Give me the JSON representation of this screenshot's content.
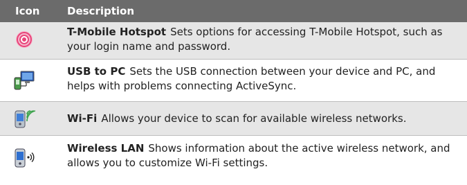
{
  "header": {
    "icon_label": "Icon",
    "description_label": "Description"
  },
  "rows": [
    {
      "icon": "hotspot-icon",
      "title": "T-Mobile Hotspot",
      "text": "Sets options for accessing T-Mobile Hotspot, such as your login name and password."
    },
    {
      "icon": "usb-to-pc-icon",
      "title": "USB to PC",
      "text": "Sets the USB connection between your device and PC, and helps with problems connecting ActiveSync."
    },
    {
      "icon": "wifi-icon",
      "title": "Wi-Fi",
      "text": "Allows your device to scan for available wireless networks."
    },
    {
      "icon": "wireless-lan-icon",
      "title": "Wireless LAN",
      "text": "Shows information about the active wireless network, and allows you to customize Wi-Fi settings."
    }
  ],
  "colors": {
    "header_bg": "#6b6b6b",
    "shaded_row": "#e6e6e6",
    "hotspot_pink": "#e8457a"
  }
}
